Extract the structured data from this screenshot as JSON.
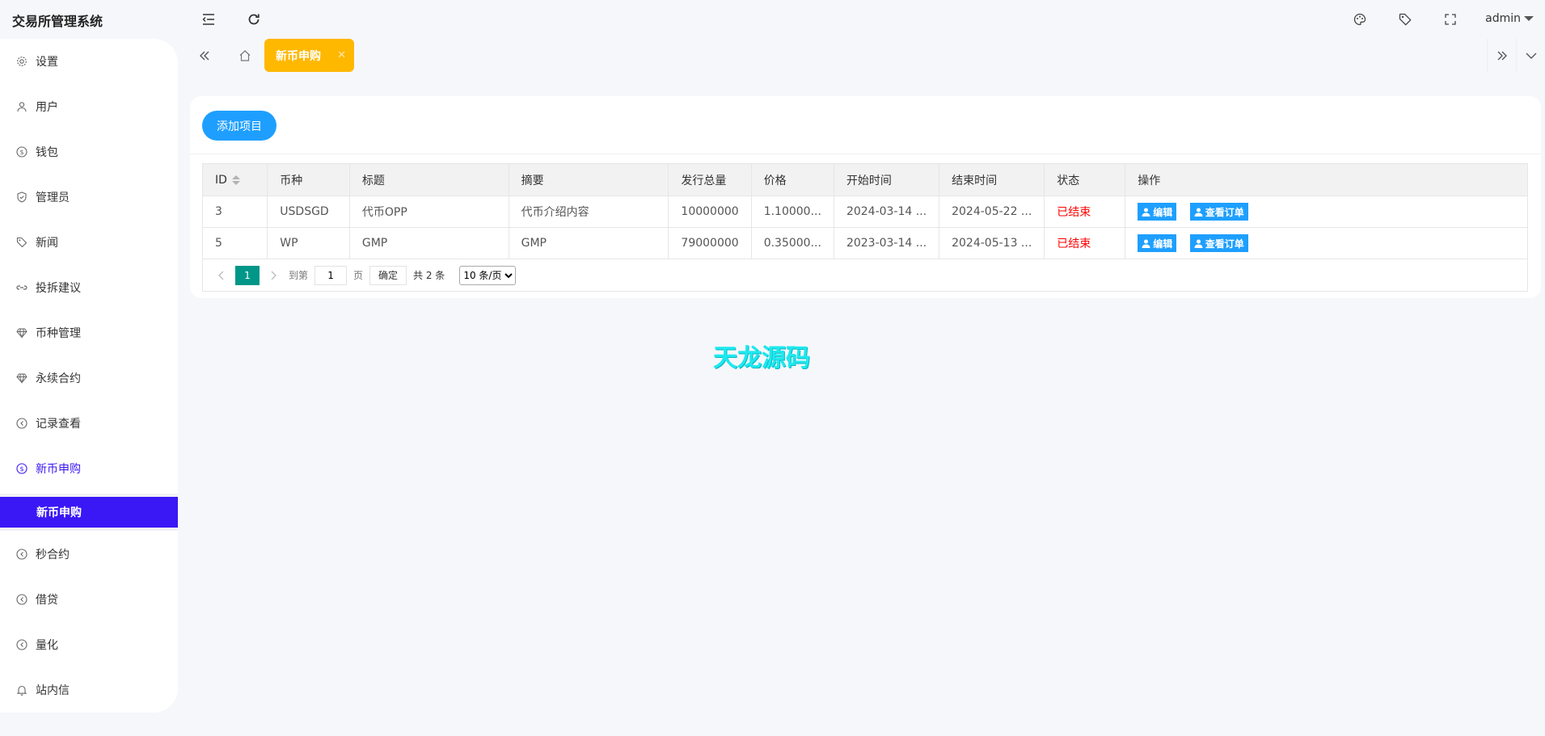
{
  "header": {
    "app_title": "交易所管理系统",
    "user": "admin"
  },
  "sidebar": {
    "items": [
      {
        "label": "设置",
        "icon": "gear-icon"
      },
      {
        "label": "用户",
        "icon": "user-icon"
      },
      {
        "label": "钱包",
        "icon": "dollar-icon"
      },
      {
        "label": "管理员",
        "icon": "shield-icon"
      },
      {
        "label": "新闻",
        "icon": "tag-icon"
      },
      {
        "label": "投拆建议",
        "icon": "link-icon"
      },
      {
        "label": "币种管理",
        "icon": "diamond-icon"
      },
      {
        "label": "永续合约",
        "icon": "diamond-icon"
      },
      {
        "label": "记录查看",
        "icon": "circle-arrow-icon"
      },
      {
        "label": "新币申购",
        "icon": "dollar-icon"
      },
      {
        "label": "秒合约",
        "icon": "circle-arrow-icon"
      },
      {
        "label": "借贷",
        "icon": "circle-arrow-icon"
      },
      {
        "label": "量化",
        "icon": "circle-arrow-icon"
      },
      {
        "label": "站内信",
        "icon": "bell-icon"
      }
    ],
    "active_sub_item": "新币申购"
  },
  "tabs": {
    "active_tab": "新币申购"
  },
  "toolbar": {
    "add_button": "添加项目"
  },
  "table": {
    "columns": [
      "ID",
      "币种",
      "标题",
      "摘要",
      "发行总量",
      "价格",
      "开始时间",
      "结束时间",
      "状态",
      "操作"
    ],
    "rows": [
      {
        "id": "3",
        "coin": "USDSGD",
        "title": "代币OPP",
        "summary": "代币介绍内容",
        "total": "10000000",
        "price": "1.10000...",
        "start": "2024-03-14 ...",
        "end": "2024-05-22 ...",
        "status": "已结束"
      },
      {
        "id": "5",
        "coin": "WP",
        "title": "GMP",
        "summary": "GMP",
        "total": "79000000",
        "price": "0.35000...",
        "start": "2023-03-14 ...",
        "end": "2024-05-13 ...",
        "status": "已结束"
      }
    ],
    "edit_label": "编辑",
    "orders_label": "查看订单"
  },
  "pager": {
    "current_page": "1",
    "goto_label": "到第",
    "goto_value": "1",
    "page_label": "页",
    "confirm_label": "确定",
    "total_label": "共 2 条",
    "page_size": "10 条/页"
  },
  "watermark": "天龙源码",
  "colors": {
    "accent": "#3a17f5",
    "primary_button": "#1e9fff",
    "tab_active": "#ffb800",
    "pager_active": "#009688",
    "status_ended": "#ff0000"
  }
}
